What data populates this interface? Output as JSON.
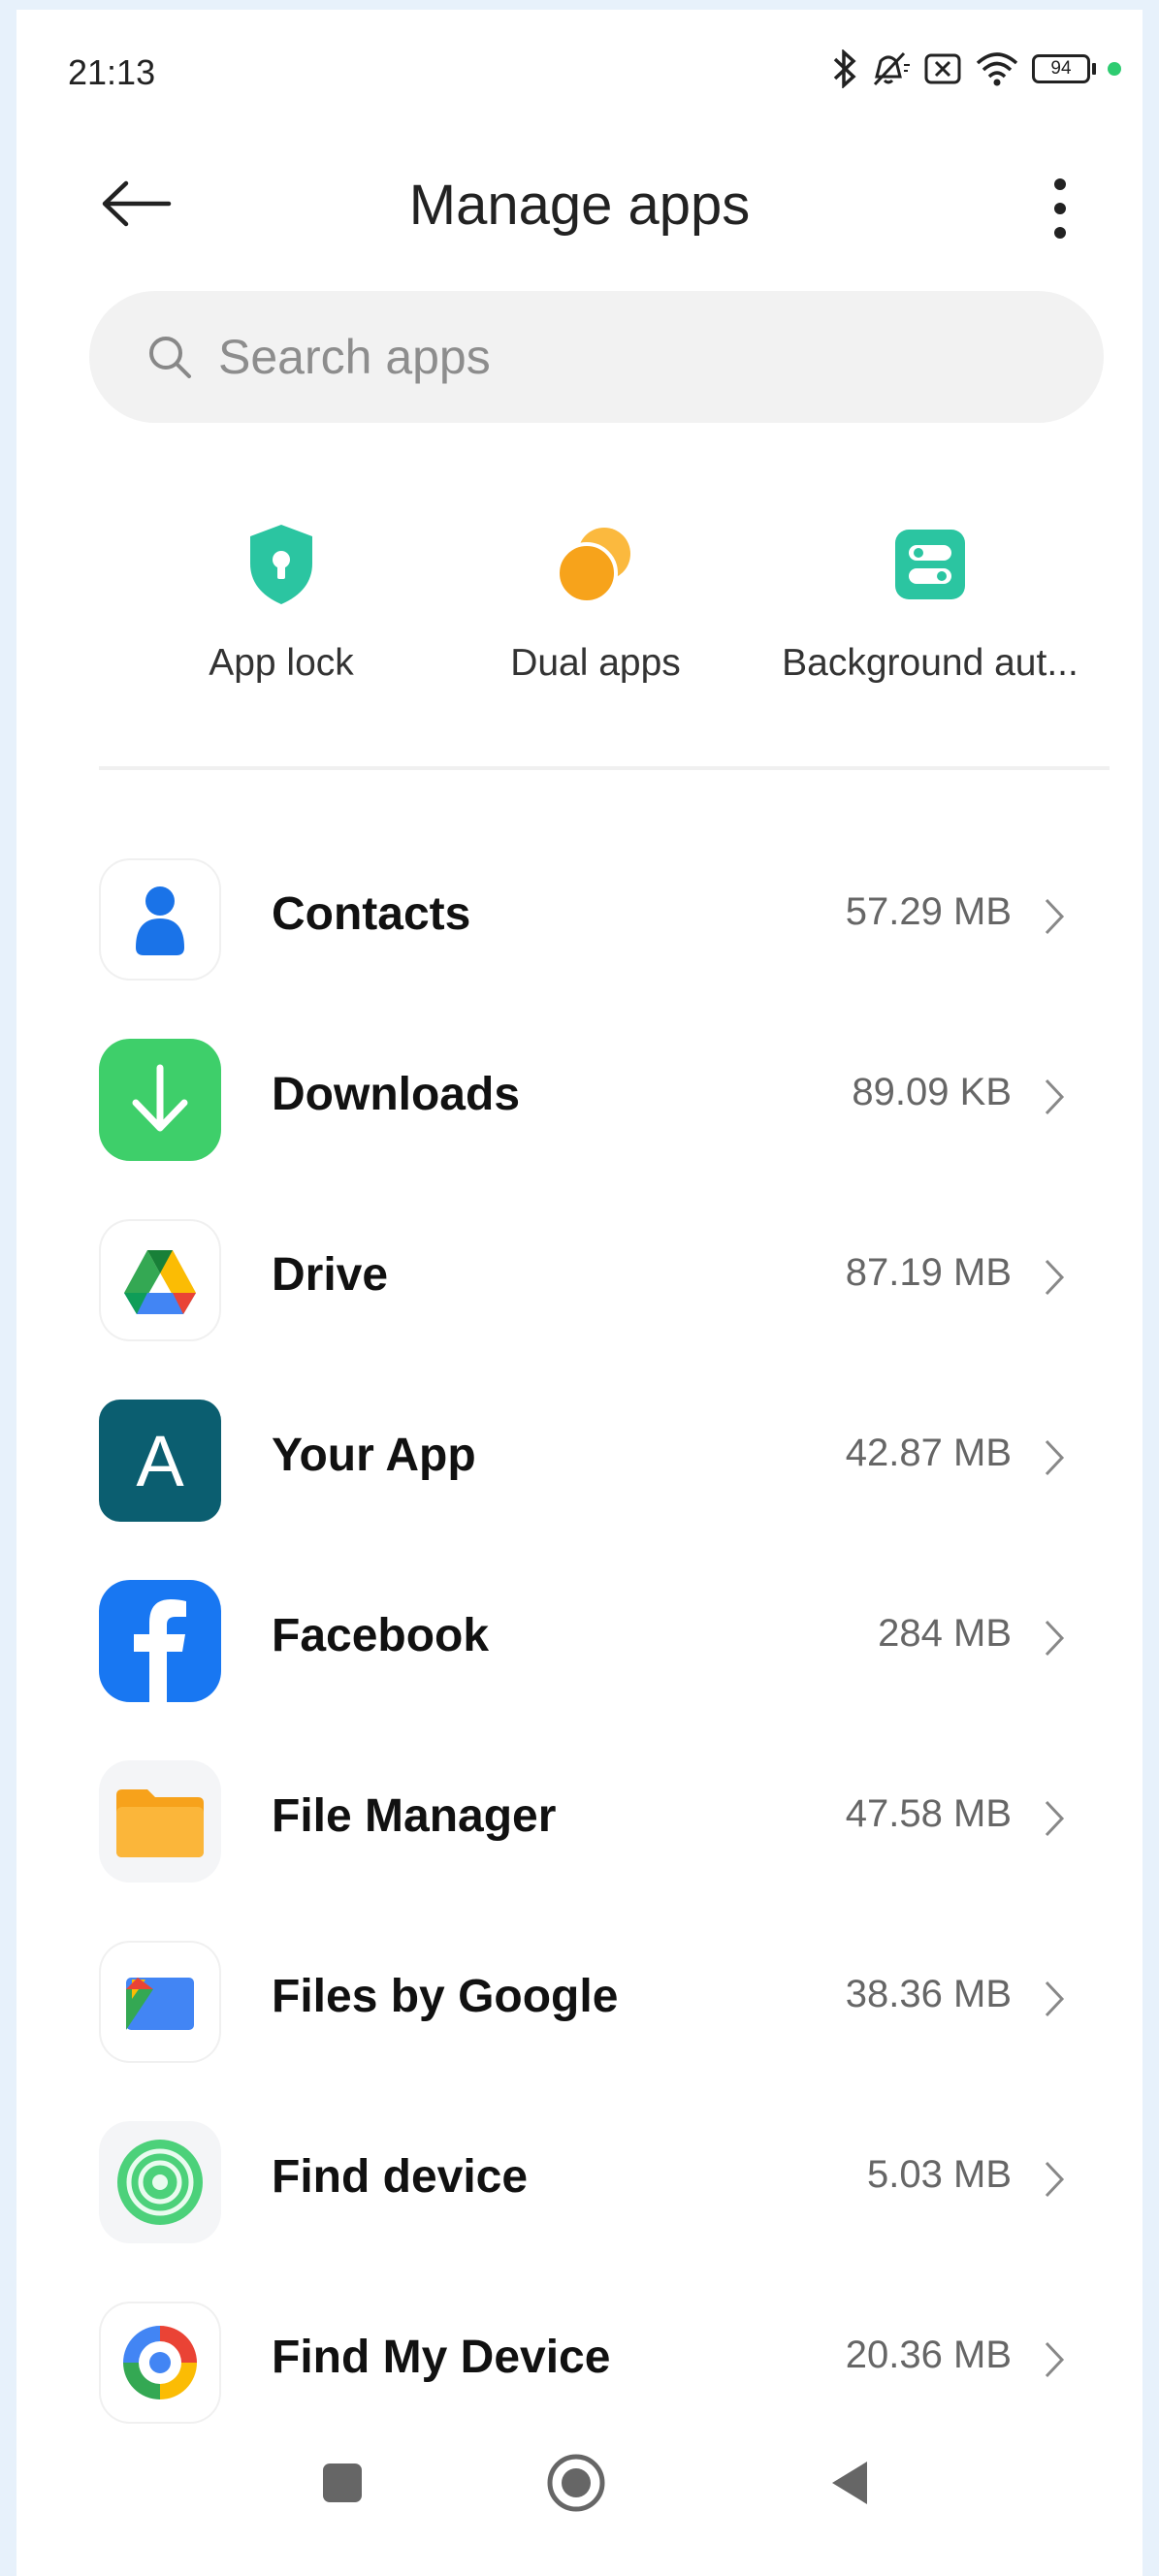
{
  "status_bar": {
    "time": "21:13",
    "battery": "94",
    "icons": [
      "bluetooth-icon",
      "mute-icon",
      "sim-off-icon",
      "wifi-icon",
      "battery-icon",
      "notification-dot"
    ]
  },
  "header": {
    "title": "Manage apps",
    "back_icon": "arrow-left-icon",
    "more_icon": "more-vertical-icon"
  },
  "search": {
    "placeholder": "Search apps",
    "value": ""
  },
  "shortcuts": [
    {
      "label": "App lock",
      "icon": "shield-lock-icon",
      "color": "#2bc5a1"
    },
    {
      "label": "Dual apps",
      "icon": "dual-circles-icon",
      "color": "#f7a91f"
    },
    {
      "label": "Background aut...",
      "icon": "toggle-icon",
      "color": "#2bc5a1"
    }
  ],
  "apps": [
    {
      "name": "Contacts",
      "size": "57.29 MB",
      "icon": "contacts-icon"
    },
    {
      "name": "Downloads",
      "size": "89.09 KB",
      "icon": "downloads-icon"
    },
    {
      "name": "Drive",
      "size": "87.19 MB",
      "icon": "drive-icon"
    },
    {
      "name": "Your App",
      "size": "42.87 MB",
      "icon": "your-app-icon"
    },
    {
      "name": "Facebook",
      "size": "284 MB",
      "icon": "facebook-icon"
    },
    {
      "name": "File Manager",
      "size": "47.58 MB",
      "icon": "file-manager-icon"
    },
    {
      "name": "Files by Google",
      "size": "38.36 MB",
      "icon": "files-by-google-icon"
    },
    {
      "name": "Find device",
      "size": "5.03 MB",
      "icon": "find-device-icon"
    },
    {
      "name": "Find My Device",
      "size": "20.36 MB",
      "icon": "find-my-device-icon"
    }
  ],
  "your_app_letter": "A",
  "nav_bar": [
    "recents-square-icon",
    "home-circle-icon",
    "back-triangle-icon"
  ]
}
